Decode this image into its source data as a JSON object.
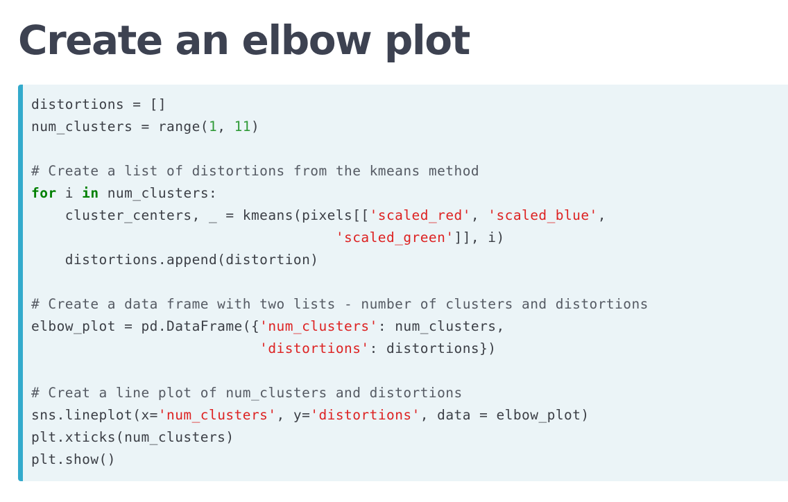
{
  "page": {
    "title": "Create an elbow plot"
  },
  "code": {
    "lines": [
      [
        {
          "t": "distortions = []",
          "c": "plain"
        }
      ],
      [
        {
          "t": "num_clusters = range(",
          "c": "plain"
        },
        {
          "t": "1",
          "c": "num"
        },
        {
          "t": ", ",
          "c": "plain"
        },
        {
          "t": "11",
          "c": "num"
        },
        {
          "t": ")",
          "c": "plain"
        }
      ],
      [],
      [
        {
          "t": "# Create a list of distortions from the kmeans method",
          "c": "com"
        }
      ],
      [
        {
          "t": "for",
          "c": "kw"
        },
        {
          "t": " i ",
          "c": "plain"
        },
        {
          "t": "in",
          "c": "kw"
        },
        {
          "t": " num_clusters:",
          "c": "plain"
        }
      ],
      [
        {
          "t": "    cluster_centers, _ = kmeans(pixels[[",
          "c": "plain"
        },
        {
          "t": "'scaled_red'",
          "c": "str"
        },
        {
          "t": ", ",
          "c": "plain"
        },
        {
          "t": "'scaled_blue'",
          "c": "str"
        },
        {
          "t": ",",
          "c": "plain"
        }
      ],
      [
        {
          "t": "                                    ",
          "c": "plain"
        },
        {
          "t": "'scaled_green'",
          "c": "str"
        },
        {
          "t": "]], i)",
          "c": "plain"
        }
      ],
      [
        {
          "t": "    distortions.append(distortion)",
          "c": "plain"
        }
      ],
      [],
      [
        {
          "t": "# Create a data frame with two lists - number of clusters and distortions",
          "c": "com"
        }
      ],
      [
        {
          "t": "elbow_plot = pd.DataFrame({",
          "c": "plain"
        },
        {
          "t": "'num_clusters'",
          "c": "str"
        },
        {
          "t": ": num_clusters,",
          "c": "plain"
        }
      ],
      [
        {
          "t": "                           ",
          "c": "plain"
        },
        {
          "t": "'distortions'",
          "c": "str"
        },
        {
          "t": ": distortions})",
          "c": "plain"
        }
      ],
      [],
      [
        {
          "t": "# Creat a line plot of num_clusters and distortions",
          "c": "com"
        }
      ],
      [
        {
          "t": "sns.lineplot(x=",
          "c": "plain"
        },
        {
          "t": "'num_clusters'",
          "c": "str"
        },
        {
          "t": ", y=",
          "c": "plain"
        },
        {
          "t": "'distortions'",
          "c": "str"
        },
        {
          "t": ", data = elbow_plot)",
          "c": "plain"
        }
      ],
      [
        {
          "t": "plt.xticks(num_clusters)",
          "c": "plain"
        }
      ],
      [
        {
          "t": "plt.show()",
          "c": "plain"
        }
      ]
    ]
  },
  "colors": {
    "title": "#3d4251",
    "code_background": "#ebf4f7",
    "code_border": "#33aacc",
    "keyword": "#008000",
    "number": "#2f9a37",
    "string": "#dd2222",
    "text": "#3b3e45"
  }
}
